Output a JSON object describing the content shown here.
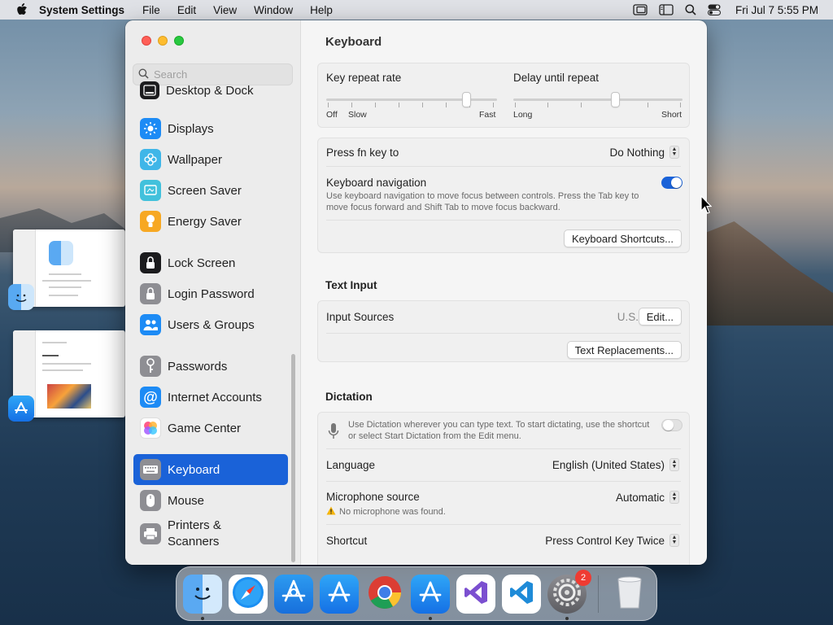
{
  "menubar": {
    "app_name": "System Settings",
    "menus": [
      "File",
      "Edit",
      "View",
      "Window",
      "Help"
    ],
    "clock": "Fri Jul 7  5:55 PM"
  },
  "sidebar": {
    "search_placeholder": "Search",
    "items": [
      {
        "label": "Desktop & Dock",
        "icon": "desktop-dock-icon",
        "color": "#1c1c1e"
      },
      {
        "label": "Displays",
        "icon": "displays-icon",
        "color": "#1d8bf5"
      },
      {
        "label": "Wallpaper",
        "icon": "wallpaper-icon",
        "color": "#3fb6e8"
      },
      {
        "label": "Screen Saver",
        "icon": "screen-saver-icon",
        "color": "#42c1dc"
      },
      {
        "label": "Energy Saver",
        "icon": "energy-saver-icon",
        "color": "#f7a823"
      },
      {
        "label": "Lock Screen",
        "icon": "lock-screen-icon",
        "color": "#1c1c1e"
      },
      {
        "label": "Login Password",
        "icon": "login-password-icon",
        "color": "#8e8e93"
      },
      {
        "label": "Users & Groups",
        "icon": "users-groups-icon",
        "color": "#1d8bf5"
      },
      {
        "label": "Passwords",
        "icon": "passwords-icon",
        "color": "#8e8e93"
      },
      {
        "label": "Internet Accounts",
        "icon": "internet-accounts-icon",
        "color": "#1d8bf5"
      },
      {
        "label": "Game Center",
        "icon": "game-center-icon",
        "color": "#ffffff"
      },
      {
        "label": "Keyboard",
        "icon": "keyboard-icon",
        "color": "#8e8e93",
        "selected": true
      },
      {
        "label": "Mouse",
        "icon": "mouse-icon",
        "color": "#8e8e93"
      },
      {
        "label": "Printers &\nScanners",
        "icon": "printers-scanners-icon",
        "color": "#8e8e93"
      }
    ]
  },
  "pane": {
    "title": "Keyboard",
    "key_repeat": {
      "label": "Key repeat rate",
      "min_label": "Off",
      "slow_label": "Slow",
      "max_label": "Fast",
      "level": 0.82
    },
    "delay_repeat": {
      "label": "Delay until repeat",
      "min_label": "Long",
      "max_label": "Short",
      "level": 0.6
    },
    "fn_key": {
      "label": "Press fn key to",
      "value": "Do Nothing"
    },
    "keyboard_navigation": {
      "label": "Keyboard navigation",
      "description": "Use keyboard navigation to move focus between controls. Press the Tab key to move focus forward and Shift Tab to move focus backward.",
      "enabled": true
    },
    "shortcuts_button": "Keyboard Shortcuts...",
    "text_input": {
      "title": "Text Input",
      "input_sources_label": "Input Sources",
      "input_sources_value": "U.S.",
      "edit_button": "Edit...",
      "replacements_button": "Text Replacements..."
    },
    "dictation": {
      "title": "Dictation",
      "description": "Use Dictation wherever you can type text. To start dictating, use the shortcut or select Start Dictation from the Edit menu.",
      "enabled": false,
      "language_label": "Language",
      "language_value": "English (United States)",
      "mic_label": "Microphone source",
      "mic_value": "Automatic",
      "mic_warning": "No microphone was found.",
      "shortcut_label": "Shortcut",
      "shortcut_value": "Press Control Key Twice"
    }
  },
  "dock": {
    "apps": [
      "Finder",
      "Safari",
      "Xcode Instruments",
      "App Store",
      "Google Chrome",
      "Xcode",
      "Visual Studio",
      "Visual Studio Code",
      "System Settings",
      "Trash"
    ],
    "settings_badge": "2"
  },
  "colors": {
    "accent": "#1a62d8"
  }
}
